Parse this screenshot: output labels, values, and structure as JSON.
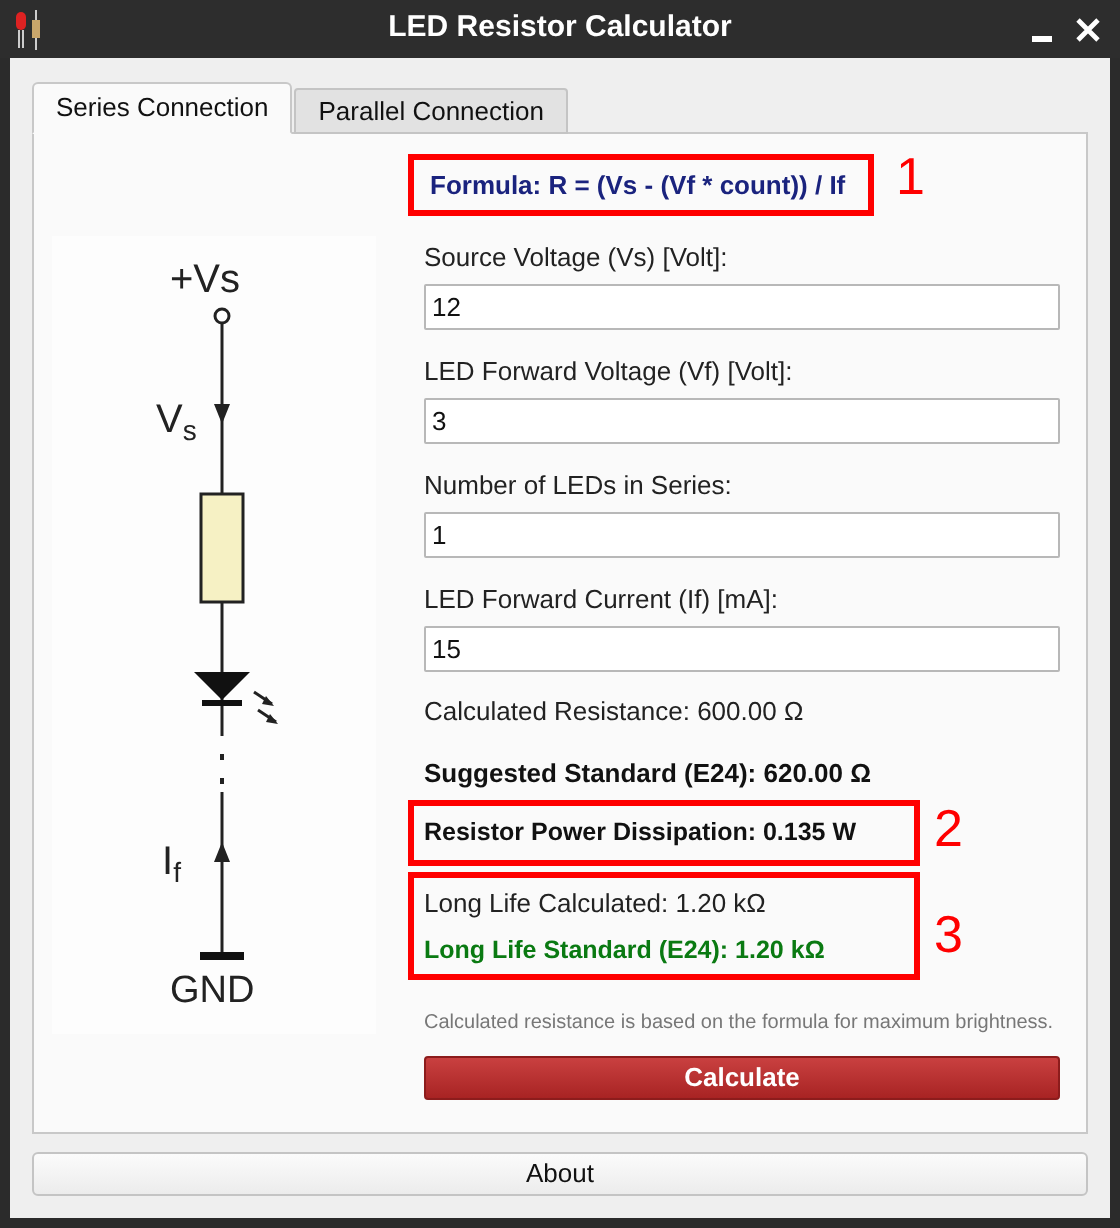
{
  "window": {
    "title": "LED Resistor Calculator"
  },
  "tabs": [
    {
      "label": "Series Connection",
      "selected": true
    },
    {
      "label": "Parallel Connection",
      "selected": false
    }
  ],
  "diagram": {
    "labels": [
      "+Vs",
      "V$_{s}$",
      "I$_{f}$",
      "GND"
    ]
  },
  "formula": "Formula: R = (Vs - (Vf * count)) / If",
  "fields": [
    {
      "label": "Source Voltage (Vs) [Volt]:",
      "value": "12"
    },
    {
      "label": "LED Forward Voltage (Vf) [Volt]:",
      "value": "3"
    },
    {
      "label": "Number of LEDs in Series:",
      "value": "1"
    },
    {
      "label": "LED Forward Current (If) [mA]:",
      "value": "15"
    }
  ],
  "results": {
    "calculated": "Calculated Resistance: 600.00 Ω",
    "suggested": "Suggested Standard (E24): 620.00 Ω",
    "power": "Resistor Power Dissipation: 0.135 W",
    "long_life_calculated": "Long Life Calculated: 1.20 kΩ",
    "long_life_standard": "Long Life Standard (E24): 1.20 kΩ"
  },
  "note": "Calculated resistance is based on the formula for maximum brightness.",
  "calculate_button": "Calculate",
  "about_button": "About",
  "callouts": [
    "1",
    "2",
    "3"
  ]
}
